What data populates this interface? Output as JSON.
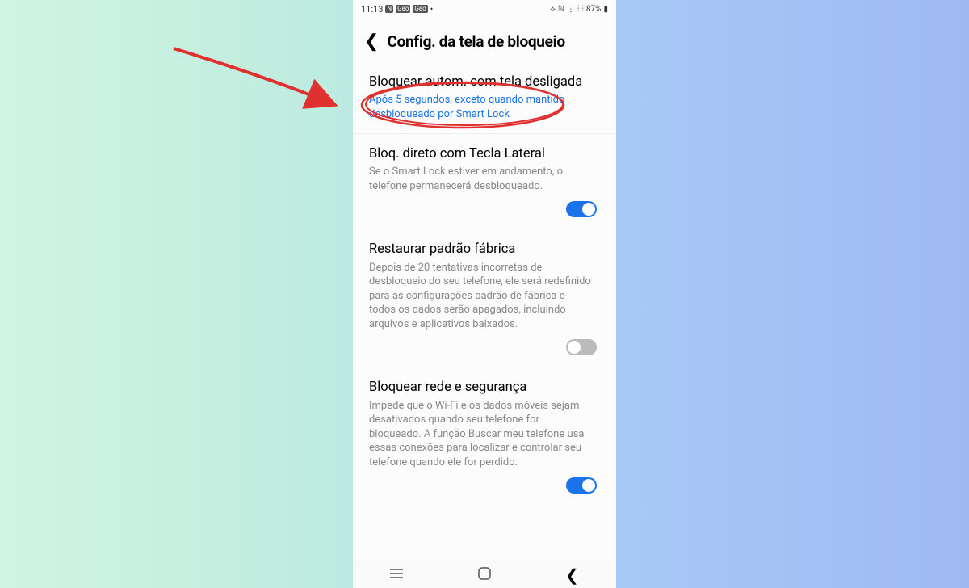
{
  "statusbar": {
    "time": "11:13",
    "battery": "87%"
  },
  "header": {
    "title": "Config. da tela de bloqueio"
  },
  "rows": {
    "auto_lock": {
      "title": "Bloquear autom. com tela desligada",
      "sub": "Após 5 segundos, exceto quando mantido desbloqueado por Smart Lock"
    },
    "side_key": {
      "title": "Bloq. direto com Tecla Lateral",
      "sub": "Se o Smart Lock estiver em andamento, o telefone permanecerá desbloqueado."
    },
    "factory": {
      "title": "Restaurar padrão fábrica",
      "sub": "Depois de 20 tentativas incorretas de desbloqueio do seu telefone, ele será redefinido para as configurações padrão de fábrica e todos os dados serão apagados, incluindo arquivos e aplicativos baixados."
    },
    "network": {
      "title": "Bloquear rede e segurança",
      "sub": "Impede que o Wi-Fi e os dados móveis sejam desativados quando seu telefone for bloqueado. A função Buscar meu telefone usa essas conexões para localizar e controlar seu telefone quando ele for perdido."
    }
  }
}
